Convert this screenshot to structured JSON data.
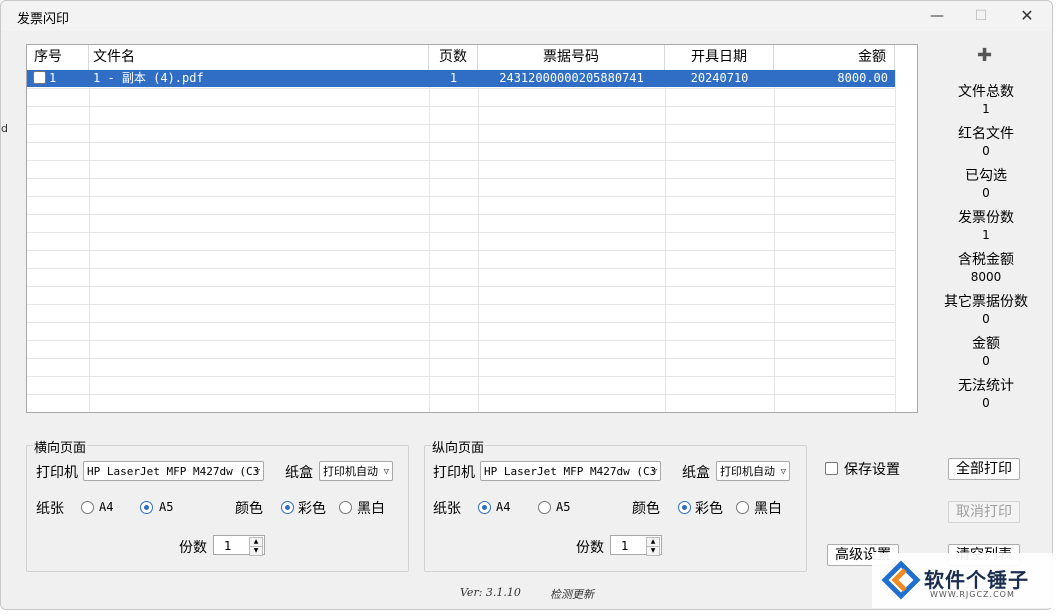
{
  "window": {
    "title": "发票闪印",
    "min_glyph": "—",
    "max_glyph": "☐",
    "close_glyph": "✕"
  },
  "edge_char": "d",
  "table": {
    "columns": [
      "序号",
      "文件名",
      "页数",
      "票据号码",
      "开具日期",
      "金额"
    ],
    "rows": [
      {
        "index": "1",
        "filename": "1 - 副本 (4).pdf",
        "pages": "1",
        "invoice_no": "24312000000205880741",
        "date": "20240710",
        "amount": "8000.00"
      }
    ]
  },
  "side": {
    "add_glyph": "✚",
    "stats": [
      {
        "label": "文件总数",
        "value": "1"
      },
      {
        "label": "红名文件",
        "value": "0"
      },
      {
        "label": "已勾选",
        "value": "0"
      },
      {
        "label": "发票份数",
        "value": "1"
      },
      {
        "label": "含税金额",
        "value": "8000"
      },
      {
        "label": "其它票据份数",
        "value": "0"
      },
      {
        "label": "金额",
        "value": "0"
      },
      {
        "label": "无法统计",
        "value": "0"
      }
    ]
  },
  "landscape": {
    "title": "横向页面",
    "printer_label": "打印机",
    "printer_value": "HP LaserJet MFP M427dw (C3",
    "tray_label": "纸盒",
    "tray_value": "打印机自动",
    "paper_label": "纸张",
    "paper_a4": "A4",
    "paper_a5": "A5",
    "color_label": "颜色",
    "color_opt": "彩色",
    "bw_opt": "黑白",
    "copies_label": "份数",
    "copies_value": "1",
    "paper_selected": "A5",
    "color_selected": "彩色"
  },
  "portrait": {
    "title": "纵向页面",
    "printer_label": "打印机",
    "printer_value": "HP LaserJet MFP M427dw (C3",
    "tray_label": "纸盒",
    "tray_value": "打印机自动",
    "paper_label": "纸张",
    "paper_a4": "A4",
    "paper_a5": "A5",
    "color_label": "颜色",
    "color_opt": "彩色",
    "bw_opt": "黑白",
    "copies_label": "份数",
    "copies_value": "1",
    "paper_selected": "A4",
    "color_selected": "彩色"
  },
  "actions": {
    "save_settings": "保存设置",
    "print_all": "全部打印",
    "cancel_print": "取消打印",
    "advanced": "高级设置",
    "clear_list": "清空列表"
  },
  "footer": {
    "version": "Ver: 3.1.10",
    "check_update": "检测更新"
  },
  "watermark": {
    "brand": "软件个锤子",
    "url": "WWW.RJGCZ.COM"
  }
}
